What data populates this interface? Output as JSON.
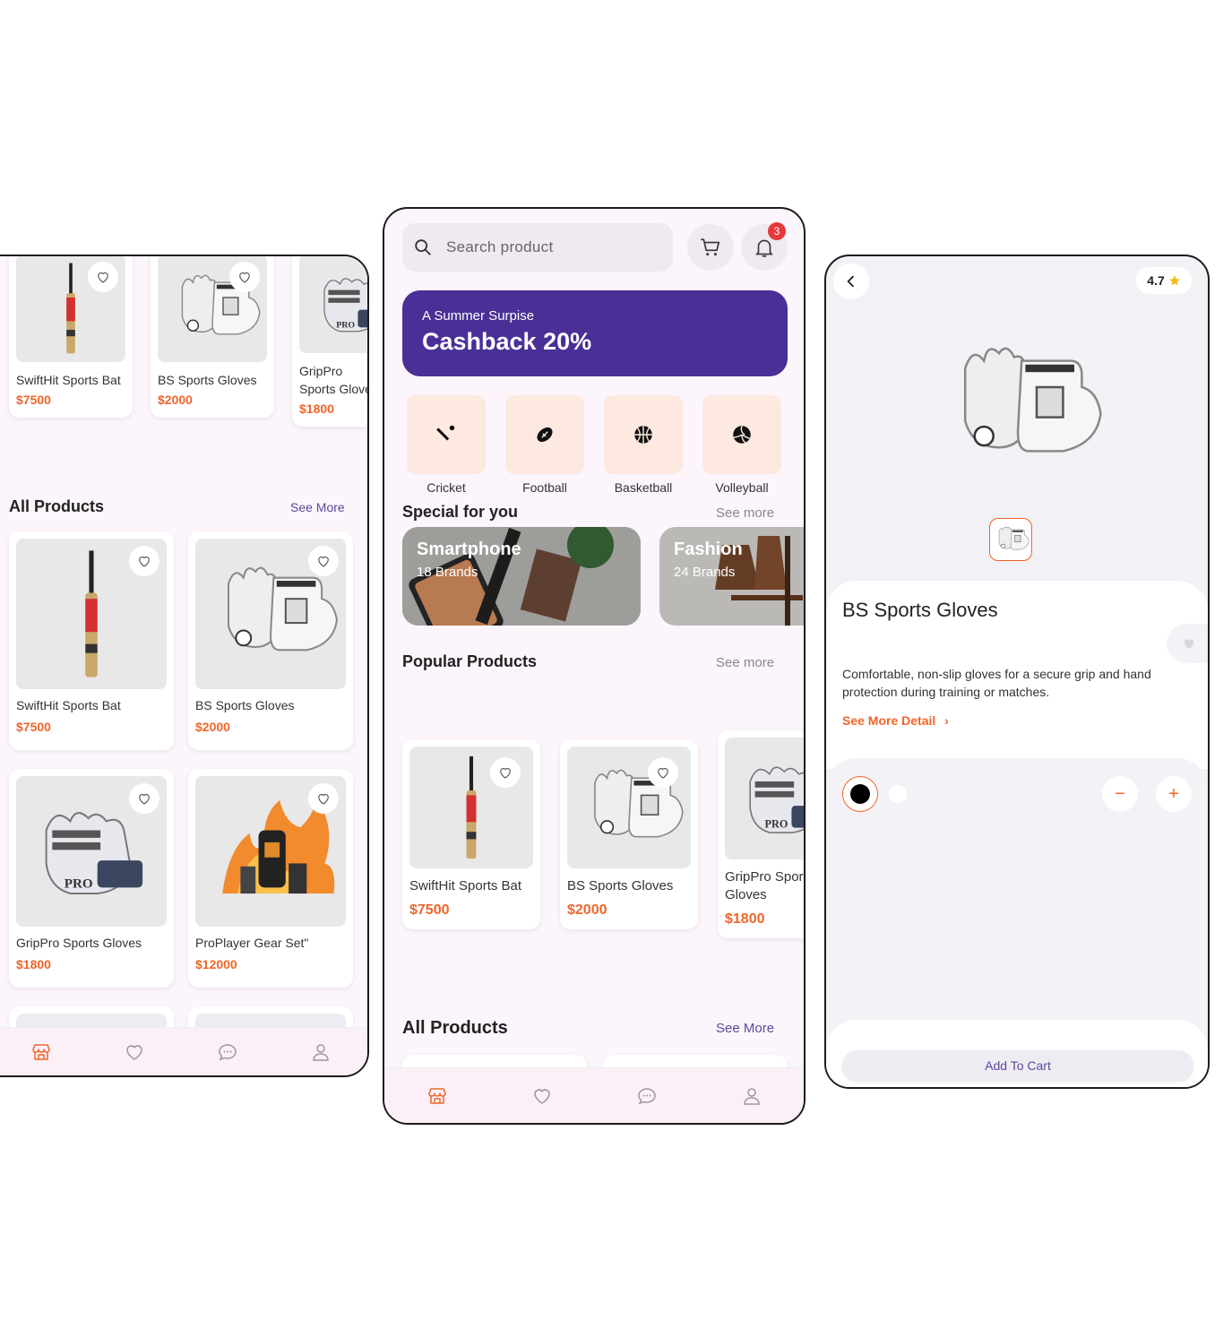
{
  "colors": {
    "accent": "#f0652a",
    "brand": "#4a2f97",
    "link": "#5a4a9a",
    "background": "#fcf5fc"
  },
  "left_screen": {
    "top_products": [
      {
        "name": "SwiftHit Sports Bat",
        "price": "$7500",
        "image": "cricket-bat"
      },
      {
        "name": "BS Sports Gloves",
        "price": "$2000",
        "image": "gloves"
      },
      {
        "name": "GripPro Sports Gloves",
        "price": "$1800",
        "image": "gloves-pro"
      }
    ],
    "all_products_title": "All Products",
    "all_products_link": "See More",
    "all_products": [
      {
        "name": "SwiftHit Sports Bat",
        "price": "$7500",
        "image": "cricket-bat"
      },
      {
        "name": "BS Sports Gloves",
        "price": "$2000",
        "image": "gloves"
      },
      {
        "name": "GripPro Sports Gloves",
        "price": "$1800",
        "image": "gloves-pro"
      },
      {
        "name": "ProPlayer Gear Set\"",
        "price": "$12000",
        "image": "gear-set"
      }
    ]
  },
  "middle_screen": {
    "search": {
      "placeholder": "Search product"
    },
    "notification_count": "3",
    "banner": {
      "subtitle": "A Summer Surpise",
      "title": "Cashback 20%"
    },
    "categories": [
      {
        "label": "Cricket",
        "icon": "cricket-icon"
      },
      {
        "label": "Football",
        "icon": "football-icon"
      },
      {
        "label": "Basketball",
        "icon": "basketball-icon"
      },
      {
        "label": "Volleyball",
        "icon": "volleyball-icon"
      }
    ],
    "special_title": "Special for you",
    "special_link": "See more",
    "specials": [
      {
        "title": "Smartphone",
        "subtitle": "18 Brands"
      },
      {
        "title": "Fashion",
        "subtitle": "24 Brands"
      }
    ],
    "popular_title": "Popular Products",
    "popular_link": "See more",
    "popular_products": [
      {
        "name": "SwiftHit Sports Bat",
        "price": "$7500"
      },
      {
        "name": "BS Sports Gloves",
        "price": "$2000"
      },
      {
        "name": "GripPro Sports Gloves",
        "price": "$1800"
      }
    ],
    "all_products_title": "All Products",
    "all_products_link": "See More"
  },
  "right_screen": {
    "rating": "4.7",
    "product_title": "BS Sports Gloves",
    "description": "Comfortable, non-slip gloves for a secure grip and hand protection during training or matches.",
    "see_more_detail": "See More Detail",
    "quantity_minus": "−",
    "quantity_plus": "+",
    "add_to_cart": "Add To Cart",
    "colors": [
      "#000000",
      "#ffffff"
    ]
  },
  "nav_items": [
    "store-icon",
    "heart-icon",
    "chat-icon",
    "user-icon"
  ]
}
